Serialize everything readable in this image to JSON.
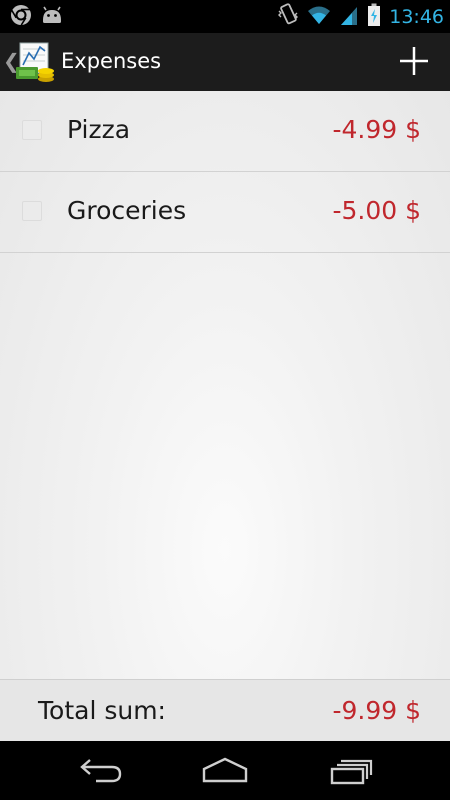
{
  "status_bar": {
    "time": "13:46",
    "icons": [
      "chrome-icon",
      "android-icon",
      "vibrate-icon",
      "wifi-icon",
      "signal-icon",
      "battery-charging-icon"
    ]
  },
  "action_bar": {
    "title": "Expenses",
    "app_icon": "expenses-app-icon",
    "add_icon": "plus-icon"
  },
  "expenses": [
    {
      "name": "Pizza",
      "amount": "-4.99 $",
      "checked": false
    },
    {
      "name": "Groceries",
      "amount": "-5.00 $",
      "checked": false
    }
  ],
  "footer": {
    "label": "Total sum:",
    "value": "-9.99 $"
  },
  "nav_bar": {
    "icons": [
      "back-icon",
      "home-icon",
      "recent-apps-icon"
    ]
  },
  "colors": {
    "accent_blue": "#33b5e5",
    "negative_amount": "#c0272d",
    "action_bar": "#1c1c1c"
  }
}
